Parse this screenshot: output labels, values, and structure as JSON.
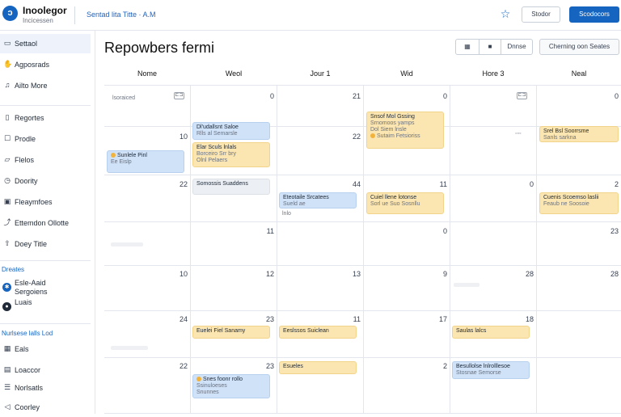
{
  "app": {
    "brand": "Inoolegor",
    "brand_sub": "Incicessen",
    "breadcrumb": "Sentad lita Titte · A.M",
    "header_btn": "Stodor",
    "header_primary": "Scodocors"
  },
  "sidebar": {
    "items_top": [
      {
        "label": "Settaol",
        "icon": "building-icon"
      },
      {
        "label": "Agposrads",
        "icon": "handshake-icon"
      },
      {
        "label": "Ailto More",
        "icon": "bell-icon"
      }
    ],
    "items_mid": [
      {
        "label": "Regortes",
        "icon": "document-icon"
      },
      {
        "label": "Prodle",
        "icon": "user-icon"
      },
      {
        "label": "Flelos",
        "icon": "folder-icon"
      },
      {
        "label": "Doority",
        "icon": "clock-icon"
      },
      {
        "label": "Fleaymfoes",
        "icon": "briefcase-icon"
      },
      {
        "label": "Ettemdon Ollotte",
        "icon": "share-icon"
      },
      {
        "label": "Doey Title",
        "icon": "upload-icon"
      }
    ],
    "section1": "Dreates",
    "section1_items": [
      {
        "line1": "Esle-Aaid",
        "line2": "Sergoiens"
      },
      {
        "line1": "Luais",
        "line2": ""
      }
    ],
    "section2": "Nurlsese lalls Lod",
    "section2_items": [
      {
        "label": "Eals",
        "icon": "grid-icon"
      },
      {
        "label": "Loaccor",
        "icon": "chart-icon"
      },
      {
        "label": "Norlsatls",
        "icon": "list-icon"
      },
      {
        "label": "Coorley",
        "icon": "send-icon"
      }
    ]
  },
  "main": {
    "title": "Repowbers fermi",
    "toolbar_btn": "Dnnse",
    "toolbar_btn2": "Cherning oon Seates",
    "day_headers": [
      "Nome",
      "Weol",
      "Jour 1",
      "Wid",
      "Hore 3",
      "Neal"
    ],
    "weeks": [
      {
        "nums": [
          "",
          "0",
          "21",
          "0",
          "",
          "0"
        ],
        "first_label": "lsoraiced"
      },
      {
        "nums": [
          "10",
          "",
          "22",
          "",
          "",
          ""
        ]
      },
      {
        "nums": [
          "22",
          "",
          "44",
          "11",
          "0",
          "2"
        ]
      },
      {
        "nums": [
          "",
          "11",
          "",
          "0",
          "",
          "23"
        ]
      },
      {
        "nums": [
          "10",
          "12",
          "13",
          "9",
          "28",
          "28"
        ]
      },
      {
        "nums": [
          "24",
          "23",
          "11",
          "17",
          "18",
          ""
        ]
      },
      {
        "nums": [
          "22",
          "23",
          "",
          "2",
          "",
          ""
        ]
      }
    ],
    "events": {
      "w0_wed": {
        "t": "Snsof Mol Gssing",
        "s": "Srnomoos yamps",
        "s2": "Dol Siem lnsle",
        "s3": "Sutaim Fetsioriss"
      },
      "w1_tue": {
        "t": "Dl'udallsnt Saloe",
        "s": "Rlls al Semarsle"
      },
      "w1_tue2": {
        "t": "Elar Sculs lnlals",
        "s": "Borceiro Srr bry",
        "s2": "Olnl Pelaers"
      },
      "w1_mon": {
        "t": "Sunlele Pinl",
        "s": "Ee Eislp"
      },
      "w1_sat": {
        "t": "Srel Bsl Soorrsme",
        "s": "Sanls sarkna"
      },
      "w2_tue": {
        "t": "Somossis Suaddens"
      },
      "w2_wed": {
        "t": "Eteotaile Srcatees",
        "s": "Sueld ae",
        "s2": "lnlo"
      },
      "w2_thu": {
        "t": "Cuiel llene lotonse",
        "s": "Sorl ue Suo Sosnllu"
      },
      "w2_sat": {
        "t": "Cuenis Scoemso laslii",
        "s": "Feaub ne Soosoie"
      },
      "w5_tue": {
        "t": "Euelei Fiel Sanamy"
      },
      "w5_wed": {
        "t": "Eeslssos Suiclean"
      },
      "w5_fri": {
        "t": "Saulas lalcs"
      },
      "w6_tue": {
        "t": "Snes foonr rollo",
        "s": "Ssinuloeses",
        "s2": "Snunnes"
      },
      "w6_wed": {
        "t": "Esueles"
      },
      "w6_fri": {
        "t": "Besullolse lnlrolllesoe",
        "s": "Stosnae Semorse"
      }
    }
  }
}
